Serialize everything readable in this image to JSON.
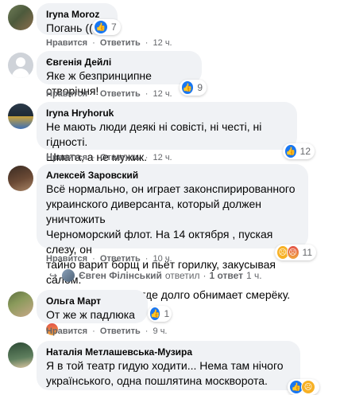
{
  "comments": [
    {
      "author": "Iryna Moroz",
      "text": "Погань ((",
      "like_label": "Нравится",
      "reply_label": "Ответить",
      "time": "12 ч.",
      "reaction_count": "7"
    },
    {
      "author": "Євгенія Дейлі",
      "text": "Яке ж безпринципне створіння!",
      "like_label": "Нравится",
      "reply_label": "Ответить",
      "time": "12 ч.",
      "reaction_count": "9"
    },
    {
      "author": "Iryna Hryhoruk",
      "text_line1": "Не мають люди деякі ні совісті, ні честі, ні гідності.",
      "text_line2": "Шмата, а не мужик.",
      "like_label": "Нравится",
      "reply_label": "Ответить",
      "time": "12 ч.",
      "reaction_count": "12"
    },
    {
      "author": "Алексей Заровский",
      "text_lines": [
        "Всё нормально, он играет законспирированного",
        "украинского диверсанта, который должен уничтожить",
        "Черноморский флот. На 14 октября , пуская слезу, он",
        "тайно варит борщ и пьёт горилку, закусывая салом.",
        "Потом едет в лес, где долго обнимает смерёку."
      ],
      "like_label": "Нравится",
      "reply_label": "Ответить",
      "time": "10 ч.",
      "reaction_count": "11",
      "replies": {
        "replier": "Євген Філінський",
        "replied_label": "ответил",
        "count_label": "1 ответ",
        "time": "1 ч."
      }
    },
    {
      "author": "Ольга Март",
      "text": "От же ж падлюка",
      "like_label": "Нравится",
      "reply_label": "Ответить",
      "time": "9 ч.",
      "reaction_count": "1"
    },
    {
      "author": "Наталія Метлашевська-Музира",
      "text_line1": "Я в той театр гидую ходити... Нема там нічого",
      "text_line2": "українського, одна пошлятина москворота."
    }
  ],
  "separators": {
    "dot": "·"
  },
  "colors": {
    "bubble": "#f0f2f5",
    "meta_text": "#65676b",
    "like_blue": "#1877f2"
  },
  "icons": {
    "like": "like-icon",
    "sad": "sad-icon",
    "angry": "angry-icon"
  }
}
